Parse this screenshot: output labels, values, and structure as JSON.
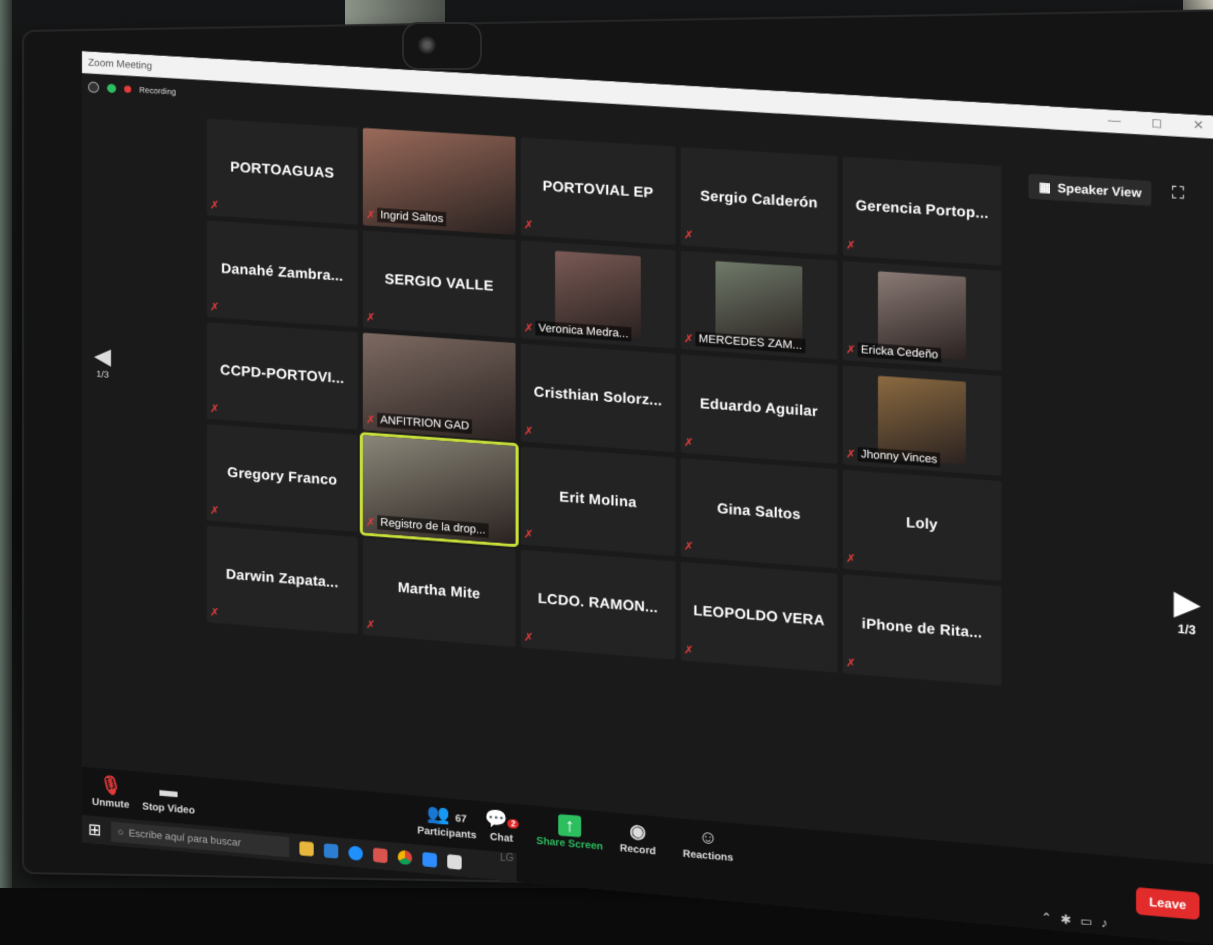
{
  "window": {
    "title": "Zoom Meeting",
    "controls": [
      "—",
      "◻",
      "✕"
    ],
    "recording_label": "Recording"
  },
  "header": {
    "speaker_view_label": "Speaker View"
  },
  "pagination": {
    "prev_label": "1/3",
    "next_label": "1/3"
  },
  "participants": [
    {
      "name": "PORTOAGUAS",
      "video": false
    },
    {
      "name": "Ingrid Saltos",
      "video": true,
      "bg": "#9a6a5a"
    },
    {
      "name": "PORTOVIAL EP",
      "video": false
    },
    {
      "name": "Sergio Calderón",
      "video": false
    },
    {
      "name": "Gerencia Portop...",
      "video": false
    },
    {
      "name": "Danahé Zambra...",
      "video": false
    },
    {
      "name": "SERGIO VALLE",
      "video": false
    },
    {
      "name": "Veronica Medra...",
      "video": true,
      "bg": "#7a5a55"
    },
    {
      "name": "MERCEDES ZAM...",
      "video": true,
      "bg": "#6f7a6a"
    },
    {
      "name": "Ericka Cedeño",
      "video": true,
      "bg": "#8a7a75"
    },
    {
      "name": "CCPD-PORTOVI...",
      "video": false
    },
    {
      "name": "ANFITRION GAD",
      "video": true,
      "bg": "#7d6a62"
    },
    {
      "name": "Cristhian Solorz...",
      "video": false
    },
    {
      "name": "Eduardo Aguilar",
      "video": false
    },
    {
      "name": "Jhonny Vinces",
      "video": true,
      "bg": "#8b6a40"
    },
    {
      "name": "Gregory Franco",
      "video": false
    },
    {
      "name": "Registro de la drop...",
      "video": true,
      "bg": "#8a8678",
      "highlight": true
    },
    {
      "name": "Erit Molina",
      "video": false
    },
    {
      "name": "Gina Saltos",
      "video": false
    },
    {
      "name": "Loly",
      "video": false
    },
    {
      "name": "Darwin Zapata...",
      "video": false
    },
    {
      "name": "Martha Mite",
      "video": false
    },
    {
      "name": "LCDO. RAMON...",
      "video": false
    },
    {
      "name": "LEOPOLDO VERA",
      "video": false
    },
    {
      "name": "iPhone de Rita...",
      "video": false
    }
  ],
  "toolbar": {
    "unmute_label": "Unmute",
    "stop_video_label": "Stop Video",
    "participants_label": "Participants",
    "participants_count": "67",
    "chat_label": "Chat",
    "chat_badge": "2",
    "share_screen_label": "Share Screen",
    "record_label": "Record",
    "reactions_label": "Reactions",
    "leave_label": "Leave"
  },
  "taskbar": {
    "search_placeholder": "Escribe aquí para buscar"
  },
  "monitor": {
    "brand": "LG"
  },
  "colors": {
    "muted_icon": "#e53b3b",
    "active_speaker": "#c8df3a",
    "share_screen": "#2dbe60",
    "leave": "#e22b2b"
  }
}
